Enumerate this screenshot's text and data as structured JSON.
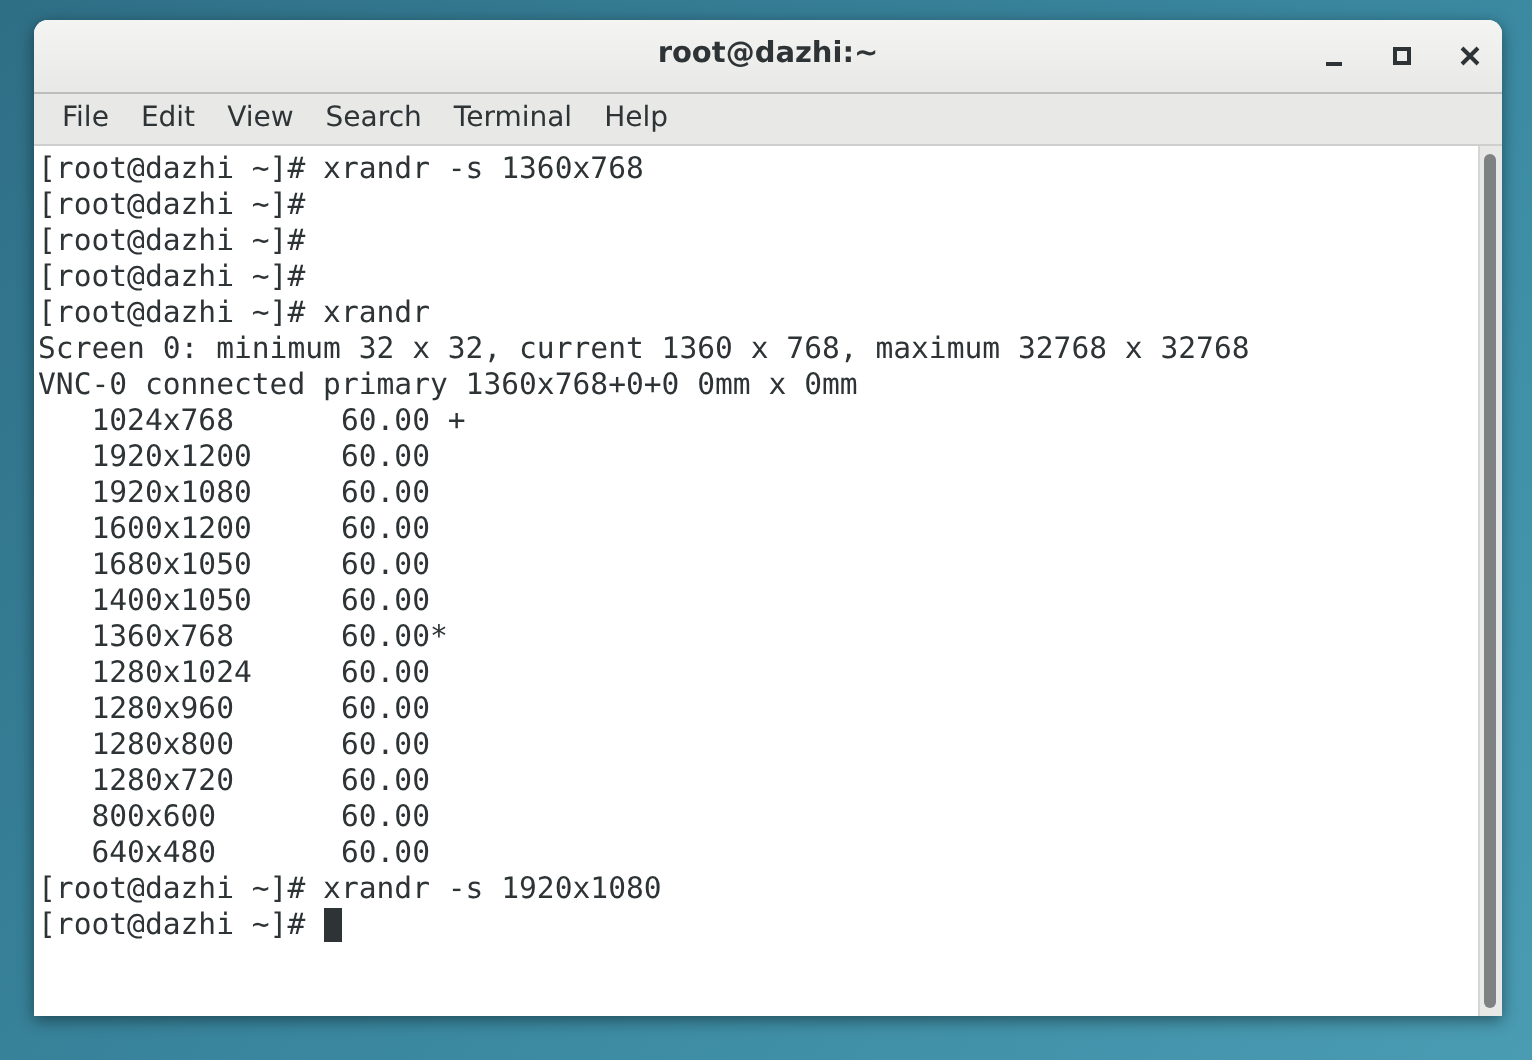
{
  "window": {
    "title": "root@dazhi:~"
  },
  "menu": [
    "File",
    "Edit",
    "View",
    "Search",
    "Terminal",
    "Help"
  ],
  "terminal": {
    "cursor_visible": true,
    "lines": [
      "[root@dazhi ~]# xrandr -s 1360x768",
      "[root@dazhi ~]#",
      "[root@dazhi ~]#",
      "[root@dazhi ~]#",
      "[root@dazhi ~]# xrandr",
      "Screen 0: minimum 32 x 32, current 1360 x 768, maximum 32768 x 32768",
      "VNC-0 connected primary 1360x768+0+0 0mm x 0mm",
      "   1024x768      60.00 +",
      "   1920x1200     60.00",
      "   1920x1080     60.00",
      "   1600x1200     60.00",
      "   1680x1050     60.00",
      "   1400x1050     60.00",
      "   1360x768      60.00*",
      "   1280x1024     60.00",
      "   1280x960      60.00",
      "   1280x800      60.00",
      "   1280x720      60.00",
      "   800x600       60.00",
      "   640x480       60.00",
      "[root@dazhi ~]# xrandr -s 1920x1080",
      "[root@dazhi ~]# "
    ]
  }
}
